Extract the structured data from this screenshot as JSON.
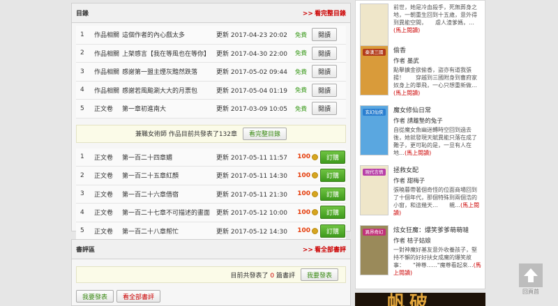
{
  "toc": {
    "title": "目錄",
    "more_arrow": ">>",
    "more_label": "看完整目錄",
    "free_chapters": [
      {
        "num": "1",
        "vol": "作品相關",
        "title": "這個作者的內心戲太多",
        "updated": "更新 2017-04-23 20:02",
        "free": "免費",
        "btn": "閱讀"
      },
      {
        "num": "2",
        "vol": "作品相關",
        "title": "上架感言【我在等風也在等你】",
        "updated": "更新 2017-04-30 22:00",
        "free": "免費",
        "btn": "閱讀"
      },
      {
        "num": "3",
        "vol": "作品相關",
        "title": "感謝第一盟主煙灰黯然跌落",
        "updated": "更新 2017-05-02 09:44",
        "free": "免費",
        "btn": "閱讀"
      },
      {
        "num": "4",
        "vol": "作品相關",
        "title": "感謝若風颱涮大大的月票包",
        "updated": "更新 2017-05-04 01:19",
        "free": "免費",
        "btn": "閱讀"
      },
      {
        "num": "5",
        "vol": "正文卷",
        "title": "第一章初進南大",
        "updated": "更新 2017-03-09 10:05",
        "free": "免費",
        "btn": "閱讀"
      }
    ],
    "notice_text": "兼職女術師 作品目前共發表了132章",
    "notice_btn": "看完整目錄",
    "paid_chapters": [
      {
        "num": "1",
        "vol": "正文卷",
        "title": "第一百二十四章媚",
        "updated": "更新 2017-05-11 11:57",
        "price": "100",
        "btn": "訂購"
      },
      {
        "num": "2",
        "vol": "正文卷",
        "title": "第一百二十五章紅顏",
        "updated": "更新 2017-05-11 14:30",
        "price": "100",
        "btn": "訂購"
      },
      {
        "num": "3",
        "vol": "正文卷",
        "title": "第一百二十六章借宿",
        "updated": "更新 2017-05-11 21:30",
        "price": "100",
        "btn": "訂購"
      },
      {
        "num": "4",
        "vol": "正文卷",
        "title": "第一百二十七章不可描述的畫面",
        "updated": "更新 2017-05-12 10:00",
        "price": "100",
        "btn": "訂購"
      },
      {
        "num": "5",
        "vol": "正文卷",
        "title": "第一百二十八章帮忙",
        "updated": "更新 2017-05-12 14:30",
        "price": "100",
        "btn": "訂購"
      }
    ]
  },
  "reviews": {
    "title": "書評區",
    "more_arrow": ">>",
    "more_label": "看全部書評",
    "count_prefix": "目前共發表了",
    "count": "0",
    "count_suffix": "篇書評",
    "post_btn": "我要發表",
    "post_btn2": "我要發表",
    "all_btn": "看全部書評"
  },
  "sidebar": {
    "books": [
      {
        "title": "",
        "author": "",
        "desc": "前世，她是冷血殺手，死無葬身之地，一朝重生回到十五歲，意外得到異能空間，　　虐人渣爹媽，…",
        "go": "(馬上閱讀)",
        "tag": "",
        "tag_color": "#888888",
        "bg": "#efe6c9"
      },
      {
        "title": "偷香",
        "author": "作者 墨武",
        "desc": "點擊擴金欲偷香，盜亦有道我張揚！　　穿越到三國附身到曹府家奴身上的單飛，一心只想重新做…",
        "go": "(馬上閱讀)",
        "tag": "秦漢三國",
        "tag_color": "#b23a1a",
        "bg": "#d99b3a"
      },
      {
        "title": "魔女修仙日常",
        "author": "作者 請離墊的兔子",
        "desc": "自從魔女魚幽迷轉時空回到過去後，她就發現天賦異能只落在成了難子，更可恥的是，一旦有人在地…",
        "go": "(馬上閱讀)",
        "tag": "玄幻仙俠",
        "tag_color": "#2b7fd0",
        "bg": "#5aa7e0"
      },
      {
        "title": "拯救女配",
        "author": "作者 甜梅子",
        "desc": "張曉暮帶著個奇怪的位面商場回到了十個年代，那個特殊到兩個浩的小窗，和這幾天…　　親…",
        "go": "(馬上閱讀)",
        "tag": "現代言情",
        "tag_color": "#b83fa8",
        "bg": "#efe6c9"
      },
      {
        "title": "炫女狂魔：爆笑爹爹萌萌噠",
        "author": "作者 桔子姑娘",
        "desc": "一對神魔好基友意外收養孩子，堅持不懈的好好扶女成魔的爆笑故事：　　\"神尊......\"魔尊看起來…",
        "go": "(馬上閱讀)",
        "tag": "異界奇幻",
        "tag_color": "#c2327a",
        "bg": "#9a8a5a"
      }
    ]
  },
  "banner_text": "帆破",
  "to_top_label": "回頁首"
}
